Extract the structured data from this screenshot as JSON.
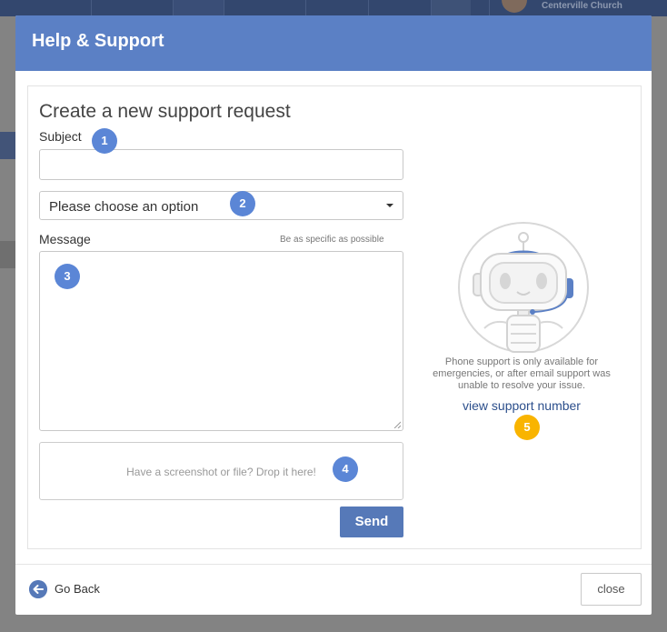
{
  "background": {
    "org_name": "Centerville Church"
  },
  "modal": {
    "title": "Help & Support",
    "heading": "Create a new support request",
    "subject_label": "Subject",
    "subject_value": "",
    "category_select": "Please choose an option",
    "message_label": "Message",
    "message_hint": "Be as specific as possible",
    "message_value": "",
    "dropzone_text": "Have a screenshot or file? Drop it here!",
    "send_label": "Send",
    "phone_note": "Phone support is only available for emergencies, or after email support was unable to resolve your issue.",
    "support_link": "view support number",
    "back_label": "Go Back",
    "close_label": "close"
  },
  "badges": [
    "1",
    "2",
    "3",
    "4",
    "5"
  ],
  "colors": {
    "header": "#5b80c5",
    "button": "#5679b8",
    "badge_blue": "#5b86d6",
    "badge_orange": "#f9b400",
    "link": "#2c4f8c"
  }
}
